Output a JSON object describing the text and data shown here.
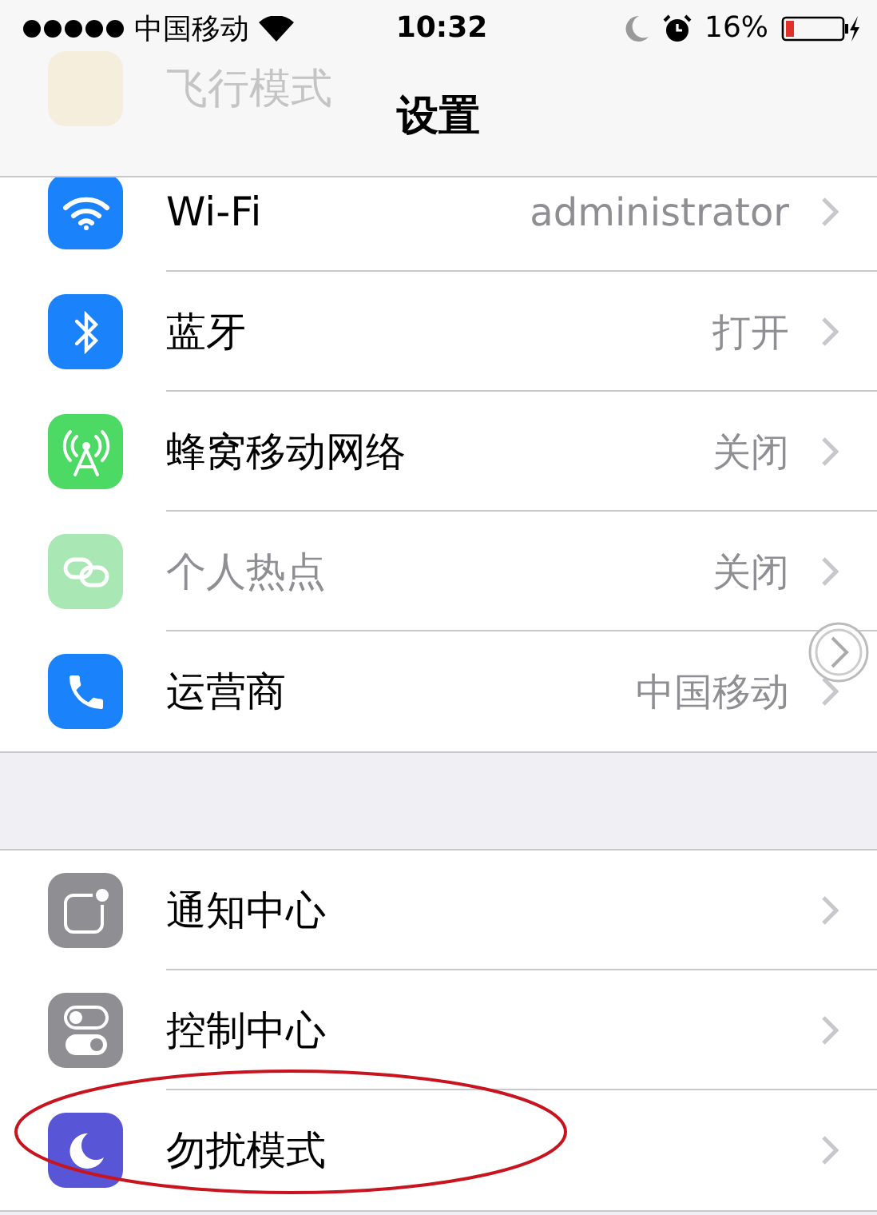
{
  "status_bar": {
    "carrier": "中国移动",
    "time": "10:32",
    "battery": "16%"
  },
  "nav": {
    "title": "设置",
    "ghost_label": "飞行模式"
  },
  "groups": [
    {
      "rows": [
        {
          "kind": "wifi",
          "color": "#1a82fb",
          "label": "Wi-Fi",
          "value": "administrator",
          "disabled": false
        },
        {
          "kind": "bluetooth",
          "color": "#1a82fb",
          "label": "蓝牙",
          "value": "打开",
          "disabled": false
        },
        {
          "kind": "cellular",
          "color": "#4cd964",
          "label": "蜂窝移动网络",
          "value": "关闭",
          "disabled": false
        },
        {
          "kind": "hotspot",
          "color": "#a9e8b4",
          "label": "个人热点",
          "value": "关闭",
          "disabled": true
        },
        {
          "kind": "phone",
          "color": "#1a82fb",
          "label": "运营商",
          "value": "中国移动",
          "disabled": false
        }
      ]
    },
    {
      "rows": [
        {
          "kind": "notification",
          "color": "#8e8e93",
          "label": "通知中心",
          "disabled": false
        },
        {
          "kind": "control",
          "color": "#8e8e93",
          "label": "控制中心",
          "disabled": false
        },
        {
          "kind": "moon",
          "color": "#5856d6",
          "label": "勿扰模式",
          "disabled": false
        }
      ]
    }
  ],
  "annotation": {
    "kind": "ellipse"
  }
}
